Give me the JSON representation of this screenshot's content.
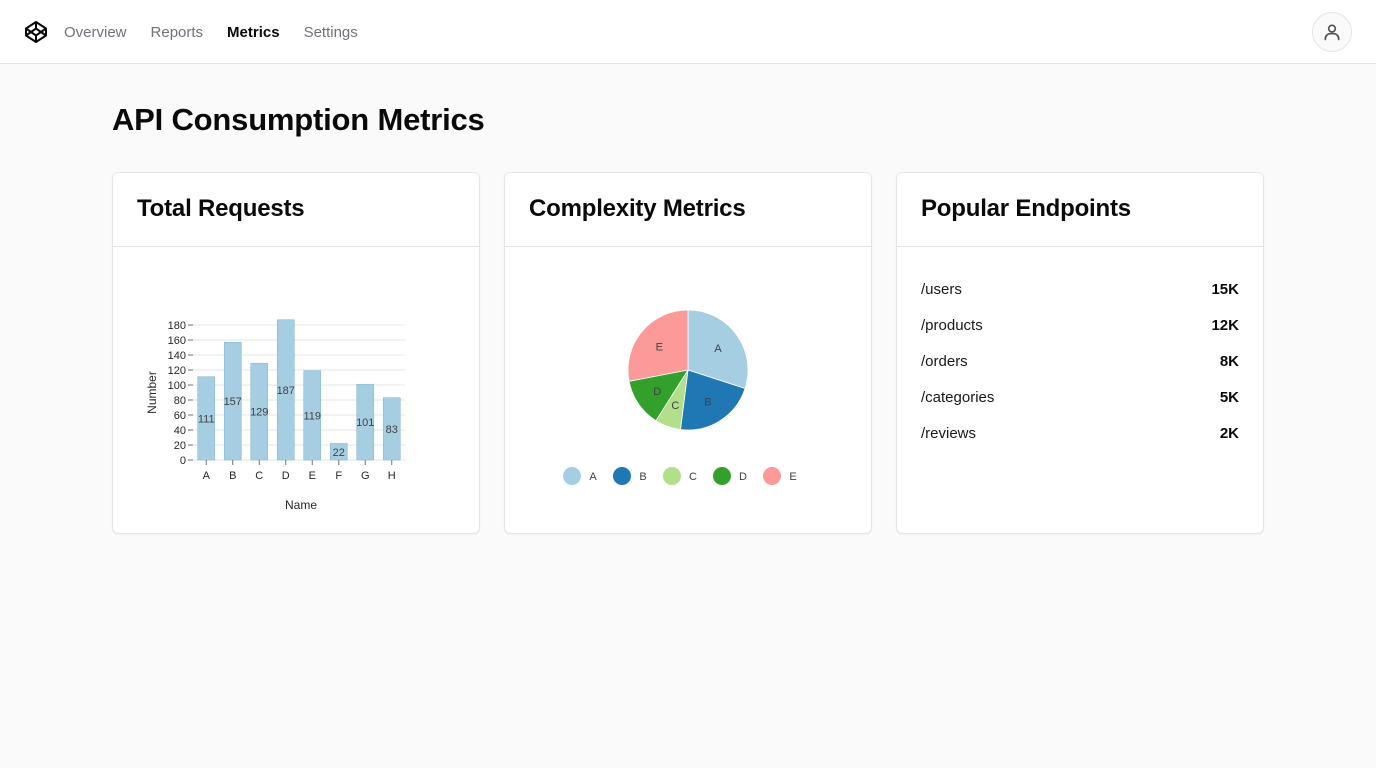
{
  "header": {
    "nav": [
      {
        "label": "Overview",
        "active": false
      },
      {
        "label": "Reports",
        "active": false
      },
      {
        "label": "Metrics",
        "active": true
      },
      {
        "label": "Settings",
        "active": false
      }
    ],
    "logo_icon": "codepen-logo-icon",
    "avatar_icon": "user-icon"
  },
  "page": {
    "title": "API Consumption Metrics"
  },
  "cards": {
    "total_requests": {
      "title": "Total Requests"
    },
    "complexity": {
      "title": "Complexity Metrics"
    },
    "endpoints": {
      "title": "Popular Endpoints",
      "items": [
        {
          "path": "/users",
          "count": "15K"
        },
        {
          "path": "/products",
          "count": "12K"
        },
        {
          "path": "/orders",
          "count": "8K"
        },
        {
          "path": "/categories",
          "count": "5K"
        },
        {
          "path": "/reviews",
          "count": "2K"
        }
      ]
    }
  },
  "chart_data": [
    {
      "type": "bar",
      "title": "Total Requests",
      "categories": [
        "A",
        "B",
        "C",
        "D",
        "E",
        "F",
        "G",
        "H"
      ],
      "values": [
        111,
        157,
        129,
        187,
        119,
        22,
        101,
        83
      ],
      "xlabel": "Name",
      "ylabel": "Number",
      "ylim": [
        0,
        180
      ],
      "yticks": [
        0,
        20,
        40,
        60,
        80,
        100,
        120,
        140,
        160,
        180
      ],
      "grid": true,
      "color": "#a6cee3"
    },
    {
      "type": "pie",
      "title": "Complexity Metrics",
      "labels": [
        "A",
        "B",
        "C",
        "D",
        "E"
      ],
      "values": [
        30,
        22,
        7,
        13,
        28
      ],
      "colors": [
        "#a6cee3",
        "#1f78b4",
        "#b2df8a",
        "#33a02c",
        "#fb9a99"
      ],
      "legend": "bottom"
    }
  ]
}
